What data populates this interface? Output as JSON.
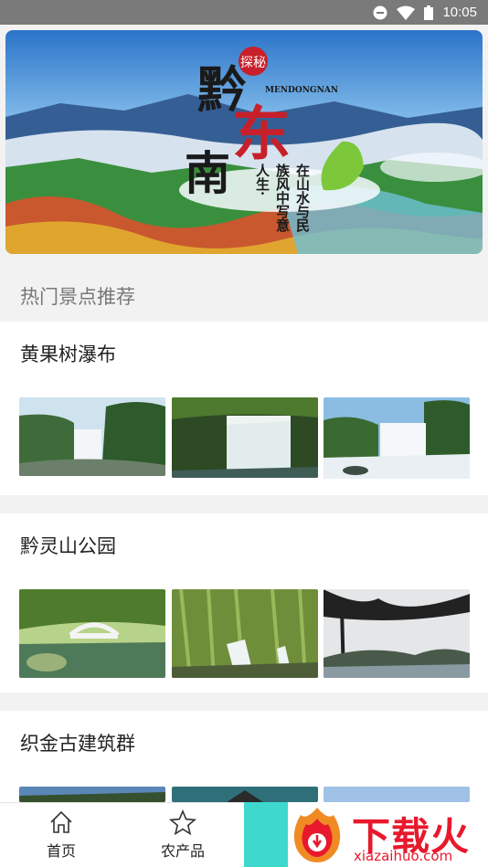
{
  "status_bar": {
    "time": "10:05"
  },
  "banner": {
    "title_chars": [
      "黔",
      "东",
      "南"
    ],
    "seal": "探秘",
    "subtitle_latin": "MENDONGNAN",
    "vertical_lines": [
      "在山水与民",
      "族风中写意",
      "人生·"
    ]
  },
  "section_heading": "热门景点推荐",
  "spots": [
    {
      "name": "黄果树瀑布"
    },
    {
      "name": "黔灵山公园"
    },
    {
      "name": "织金古建筑群"
    }
  ],
  "tabs": [
    {
      "label": "首页",
      "icon": "home-icon"
    },
    {
      "label": "农产品",
      "icon": "star-icon"
    }
  ],
  "watermark": {
    "logo_text": "下载火",
    "url": "xiazaihuo.com"
  }
}
